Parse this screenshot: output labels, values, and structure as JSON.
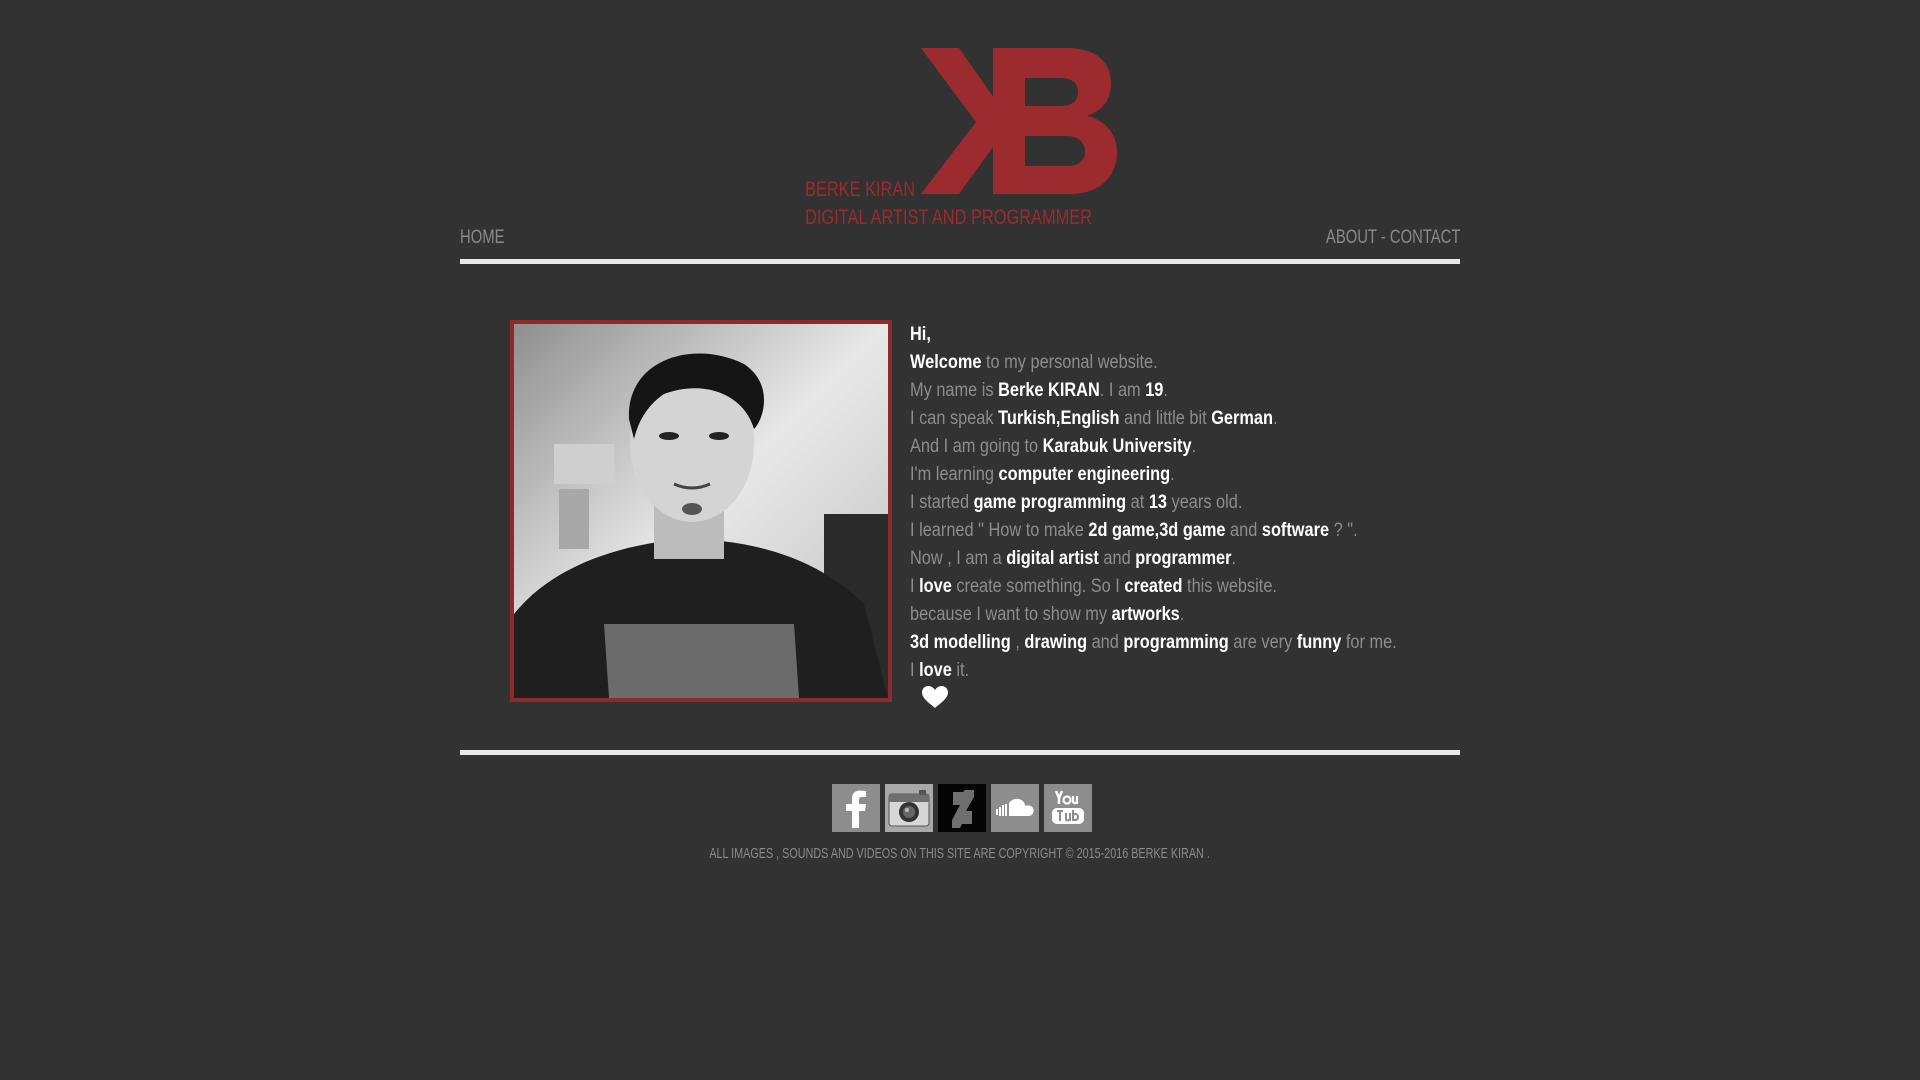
{
  "header": {
    "logo_letters": "KB",
    "brand_name": "BERKE KIRAN",
    "brand_tagline": "DIGITAL ARTIST AND PROGRAMMER",
    "accent_color": "#9b2b2e"
  },
  "nav": {
    "home": "HOME",
    "about": "ABOUT",
    "separator": "-",
    "contact": "CONTACT"
  },
  "bio": {
    "l1": {
      "a": "Hi,"
    },
    "l2": {
      "a": "Welcome",
      "b": " to my personal website."
    },
    "l3": {
      "a": "My name is ",
      "b": "Berke KIRAN",
      "c": ". I am ",
      "d": "19",
      "e": "."
    },
    "l4": {
      "a": "I can speak ",
      "b": "Turkish",
      "c": ",",
      "d": "English",
      "e": " and little bit ",
      "f": "German",
      "g": "."
    },
    "l5": {
      "a": "And I am going to ",
      "b": "Karabuk University",
      "c": "."
    },
    "l6": {
      "a": "I'm learning ",
      "b": "computer engineering",
      "c": "."
    },
    "l7": {
      "a": "I started ",
      "b": "game programming",
      "c": " at ",
      "d": "13",
      "e": " years old."
    },
    "l8": {
      "a": "I learned \" How to make ",
      "b": "2d game",
      "c": ",",
      "d": "3d game",
      "e": " and ",
      "f": "software",
      "g": " ? \"."
    },
    "l9": {
      "a": "Now , I am a ",
      "b": "digital artist",
      "c": " and ",
      "d": "programmer",
      "e": "."
    },
    "l10": {
      "a": "I ",
      "b": "love",
      "c": " create something. So I ",
      "d": "created",
      "e": " this website."
    },
    "l11": {
      "a": "because I want to show my ",
      "b": "artworks",
      "c": "."
    },
    "l12": {
      "a": "3d modelling",
      "b": " , ",
      "c": "drawing",
      "d": " and ",
      "e": "programming",
      "f": " are very ",
      "g": "funny",
      "h": " for me."
    },
    "l13": {
      "a": "I ",
      "b": "love",
      "c": " it."
    }
  },
  "icons": {
    "heart": "heart-icon",
    "facebook": "facebook-icon",
    "instagram": "instagram-icon",
    "deviantart": "deviantart-icon",
    "soundcloud": "soundcloud-icon",
    "youtube": "youtube-icon"
  },
  "footer": {
    "copyright": "ALL IMAGES , SOUNDS AND VIDEOS ON THIS SITE ARE COPYRIGHT © 2015-2016 BERKE KIRAN ."
  }
}
